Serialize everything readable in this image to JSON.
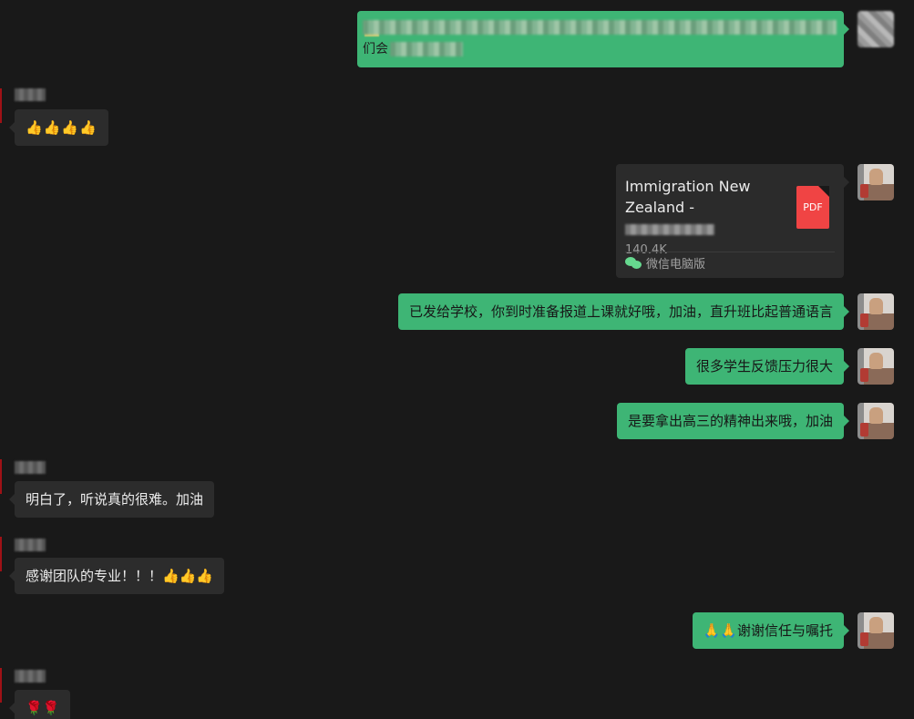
{
  "top_message": {
    "visible_text": "们会"
  },
  "messages": [
    {
      "id": "thumbs-left-1",
      "side": "left",
      "text": "👍👍👍👍"
    },
    {
      "id": "file-message",
      "side": "right",
      "file": {
        "title": "Immigration New Zealand - ",
        "size": "140.4K",
        "icon_label": "PDF",
        "icon": "pdf-file-icon",
        "source_icon": "wechat-icon",
        "source": "微信电脑版"
      }
    },
    {
      "id": "msg-school",
      "side": "right",
      "text": "已发给学校，你到时准备报道上课就好哦，加油，直升班比起普通语言"
    },
    {
      "id": "msg-pressure",
      "side": "right",
      "text": "很多学生反馈压力很大"
    },
    {
      "id": "msg-spirit",
      "side": "right",
      "text": "是要拿出高三的精神出来哦，加油"
    },
    {
      "id": "msg-understood",
      "side": "left",
      "sender": "谢子",
      "text": "明白了，听说真的很难。加油"
    },
    {
      "id": "msg-thanks",
      "side": "left",
      "text": "感谢团队的专业！！！👍👍👍"
    },
    {
      "id": "msg-trust",
      "side": "right",
      "text": "🙏🙏谢谢信任与嘱托"
    },
    {
      "id": "msg-roses",
      "side": "left",
      "text": "🌹🌹"
    }
  ],
  "colors": {
    "background": "#191919",
    "self_bubble": "#3eb575",
    "other_bubble": "#2c2c2c",
    "pdf_red": "#f04444",
    "wechat_green": "#66d98f"
  }
}
